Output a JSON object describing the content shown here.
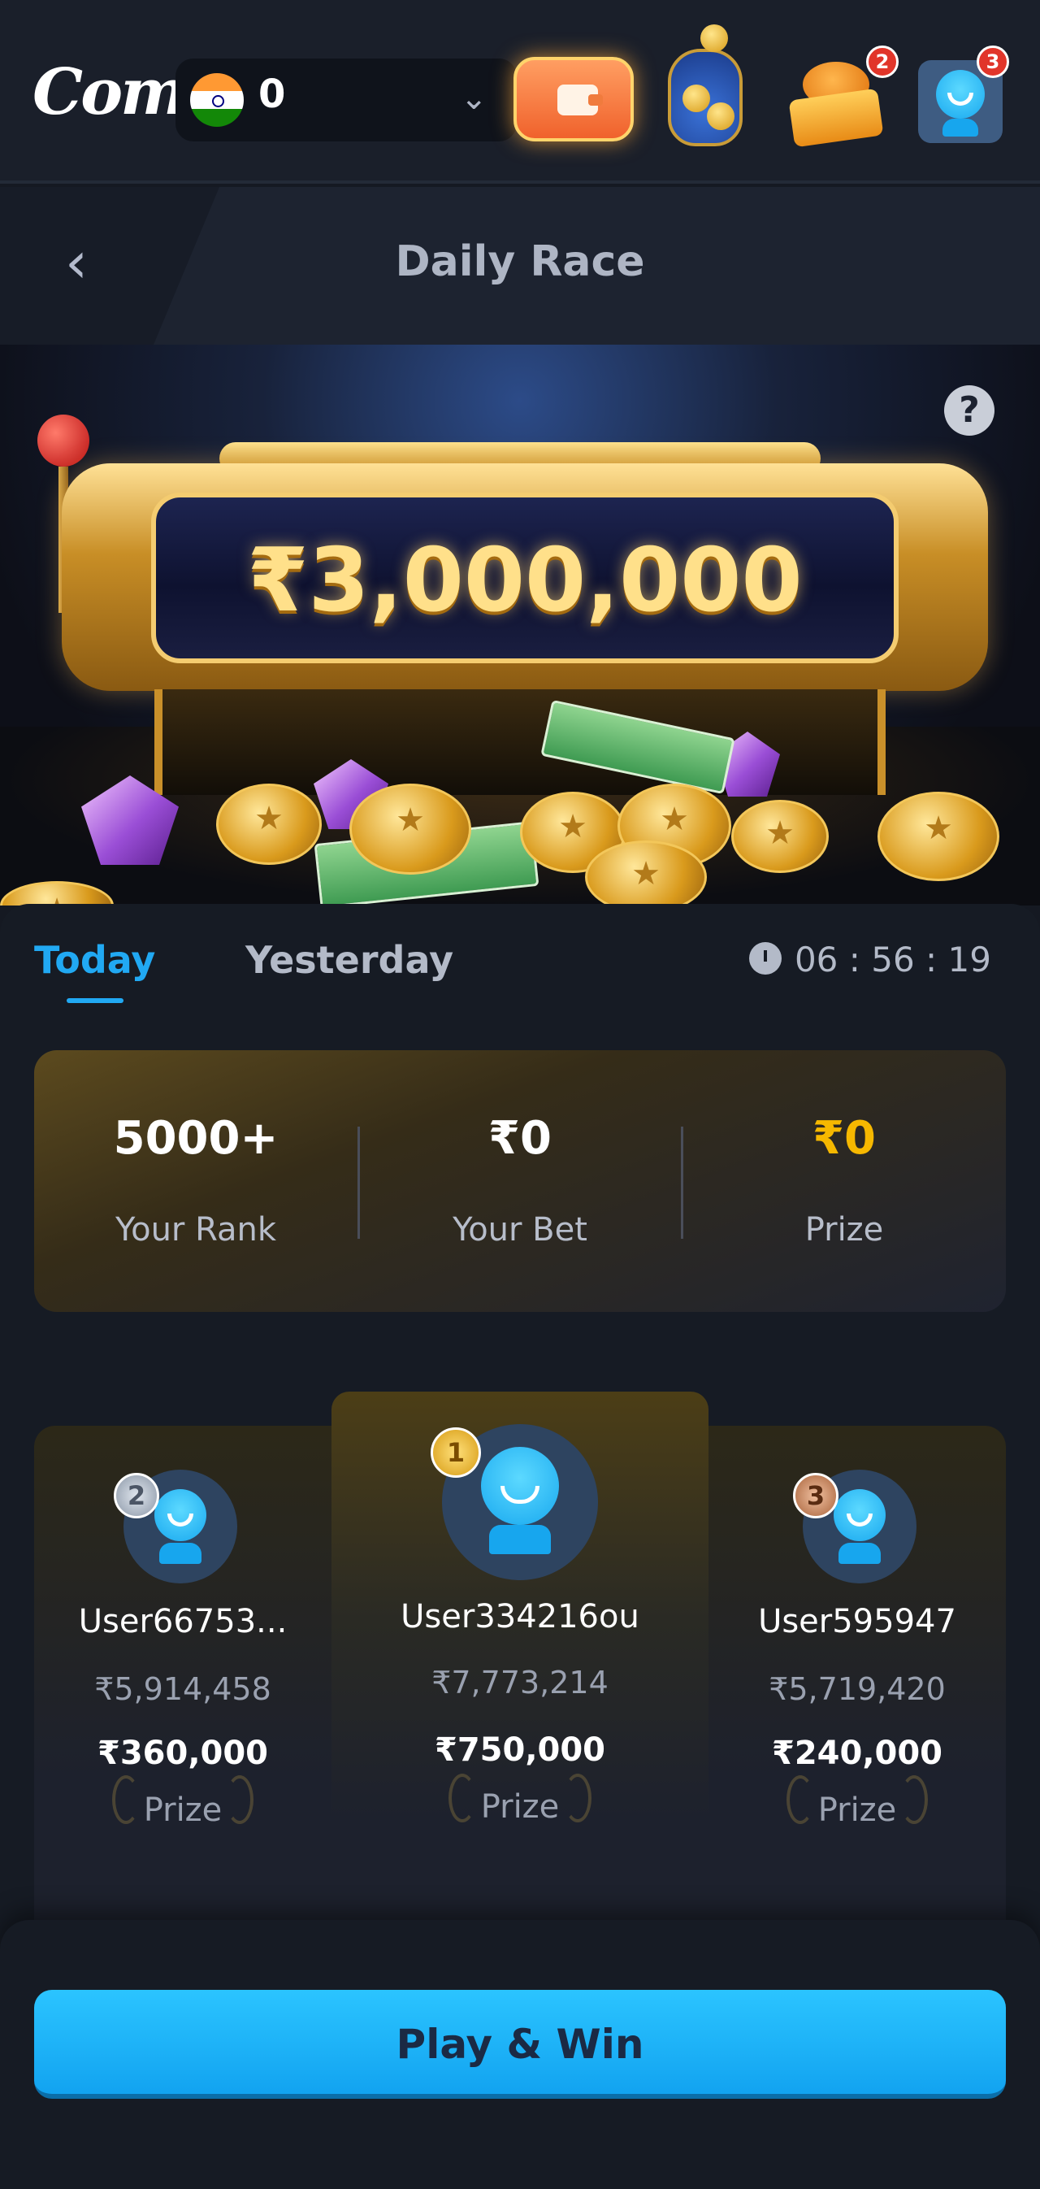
{
  "header": {
    "logo": "Come",
    "balance": "0",
    "notifications": {
      "gift_count": "2",
      "profile_count": "3"
    }
  },
  "nav": {
    "title": "Daily Race"
  },
  "hero": {
    "jackpot": "₹3,000,000",
    "help": "?"
  },
  "tabs": [
    {
      "label": "Today",
      "active": true
    },
    {
      "label": "Yesterday",
      "active": false
    }
  ],
  "timer": "06 : 56 : 19",
  "stats": [
    {
      "value": "5000+",
      "label": "Your Rank"
    },
    {
      "value": "₹0",
      "label": "Your Bet"
    },
    {
      "value": "₹0",
      "label": "Prize"
    }
  ],
  "leaderboard": [
    {
      "rank": "2",
      "user": "User66753...",
      "bet": "₹5,914,458",
      "prize": "₹360,000",
      "prize_label": "Prize"
    },
    {
      "rank": "1",
      "user": "User334216ou",
      "bet": "₹7,773,214",
      "prize": "₹750,000",
      "prize_label": "Prize"
    },
    {
      "rank": "3",
      "user": "User595947",
      "bet": "₹5,719,420",
      "prize": "₹240,000",
      "prize_label": "Prize"
    }
  ],
  "cta": {
    "label": "Play & Win"
  },
  "colors": {
    "accent": "#21a9f3",
    "gold": "#f6b800",
    "background": "#151922"
  },
  "icons": [
    "india-flag-icon",
    "chevron-down-icon",
    "wallet-icon",
    "treasure-jar-icon",
    "gift-icon",
    "avatar-icon",
    "back-arrow-icon",
    "help-icon",
    "stopwatch-icon",
    "medal-icon"
  ]
}
